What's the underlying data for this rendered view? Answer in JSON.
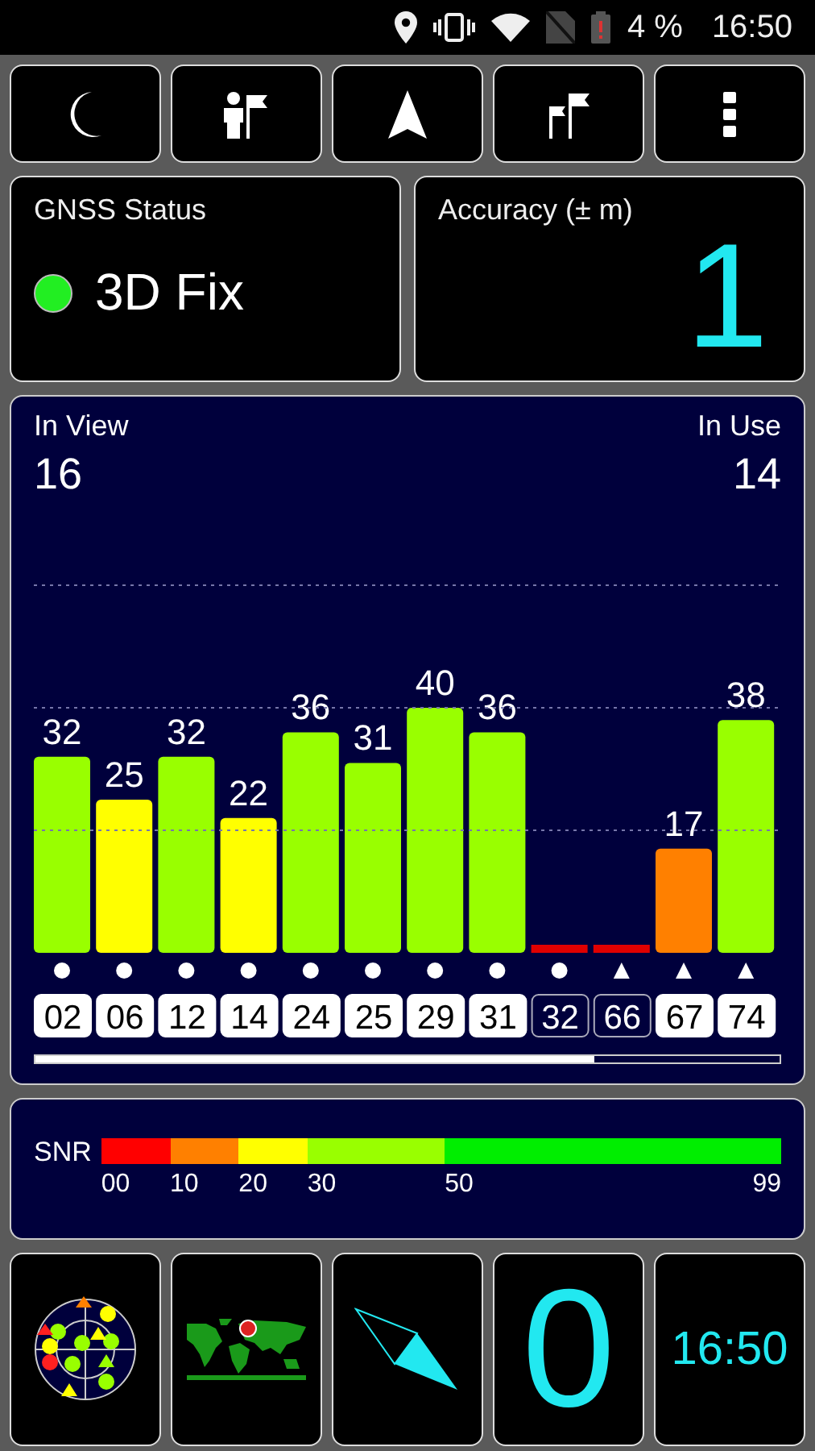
{
  "status_bar": {
    "battery": "4 %",
    "time": "16:50"
  },
  "gnss_status": {
    "title": "GNSS Status",
    "value": "3D Fix"
  },
  "accuracy": {
    "title": "Accuracy (± m)",
    "value": "1"
  },
  "satellites": {
    "in_view_label": "In View",
    "in_view": "16",
    "in_use_label": "In Use",
    "in_use": "14",
    "items": [
      {
        "kind": "circle",
        "used": true,
        "color": "#99ff00"
      },
      {
        "kind": "circle",
        "used": true,
        "color": "#ffff00"
      },
      {
        "kind": "circle",
        "used": true,
        "color": "#99ff00"
      },
      {
        "kind": "circle",
        "used": true,
        "color": "#ffff00"
      },
      {
        "kind": "circle",
        "used": true,
        "color": "#99ff00"
      },
      {
        "kind": "circle",
        "used": true,
        "color": "#99ff00"
      },
      {
        "kind": "circle",
        "used": true,
        "color": "#99ff00"
      },
      {
        "kind": "circle",
        "used": true,
        "color": "#99ff00"
      },
      {
        "kind": "circle",
        "used": false,
        "color": "#e00000"
      },
      {
        "kind": "triangle",
        "used": false,
        "color": "#e00000"
      },
      {
        "kind": "triangle",
        "used": true,
        "color": "#ff8000"
      },
      {
        "kind": "triangle",
        "used": true,
        "color": "#99ff00"
      }
    ],
    "chart_data": {
      "type": "bar",
      "categories": [
        "02",
        "06",
        "12",
        "14",
        "24",
        "25",
        "29",
        "31",
        "32",
        "66",
        "67",
        "74"
      ],
      "values": [
        32,
        25,
        32,
        22,
        36,
        31,
        40,
        36,
        0,
        0,
        17,
        38
      ],
      "value_labels": [
        "32",
        "25",
        "32",
        "22",
        "36",
        "31",
        "40",
        "36",
        null,
        null,
        "17",
        "38"
      ]
    }
  },
  "snr_scale": {
    "label": "SNR",
    "segments": [
      {
        "start": "00",
        "color": "#ff0000"
      },
      {
        "start": "10",
        "color": "#ff8000"
      },
      {
        "start": "20",
        "color": "#ffff00"
      },
      {
        "start": "30",
        "color": "#99ff00"
      },
      {
        "start": "50",
        "color": "#00ee00"
      }
    ],
    "end": "99"
  },
  "bottom_tiles": [
    {
      "kind": "skyplot"
    },
    {
      "kind": "map"
    },
    {
      "kind": "compass"
    },
    {
      "kind": "value",
      "text": "0"
    },
    {
      "kind": "clock",
      "text": "16:50"
    }
  ]
}
